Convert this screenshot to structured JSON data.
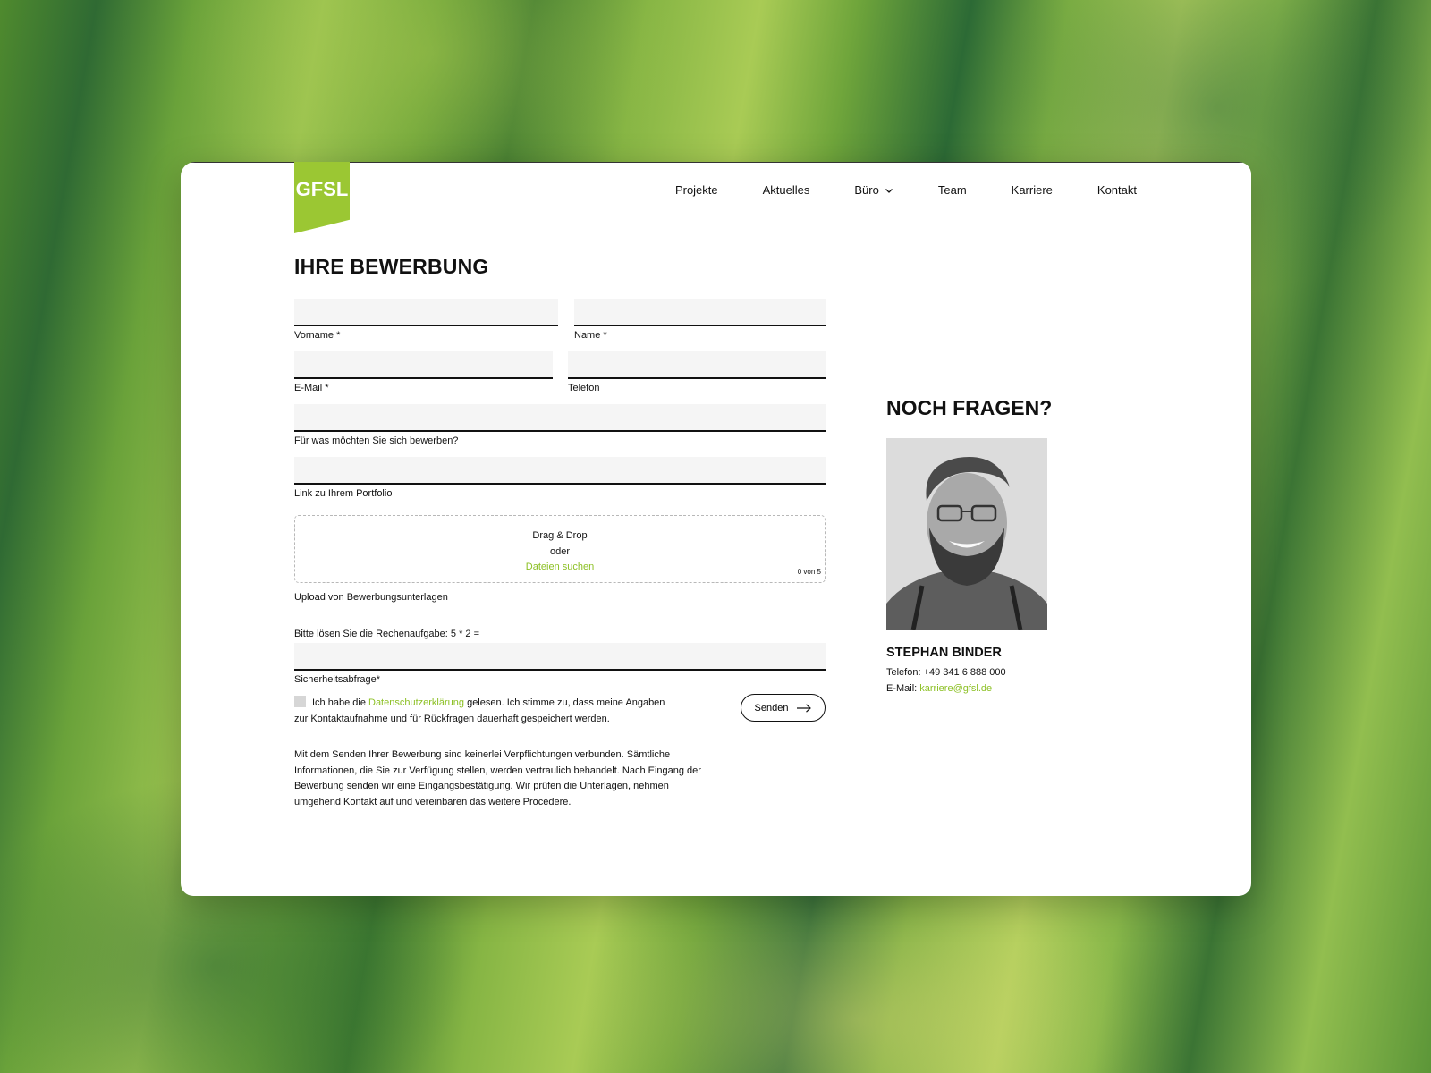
{
  "site": {
    "logo_text": "GFSL",
    "brand_color": "#9bc733",
    "link_color": "#8cc024"
  },
  "nav": {
    "items": [
      {
        "label": "Projekte"
      },
      {
        "label": "Aktuelles"
      },
      {
        "label": "Büro",
        "has_dropdown": true
      },
      {
        "label": "Team"
      },
      {
        "label": "Karriere"
      },
      {
        "label": "Kontakt"
      }
    ]
  },
  "form": {
    "title": "IHRE BEWERBUNG",
    "fields": {
      "first_name": {
        "label": "Vorname *",
        "value": ""
      },
      "last_name": {
        "label": "Name *",
        "value": ""
      },
      "email": {
        "label": "E-Mail *",
        "value": ""
      },
      "phone": {
        "label": "Telefon",
        "value": ""
      },
      "position": {
        "label": "Für was möchten Sie sich bewerben?",
        "value": ""
      },
      "portfolio": {
        "label": "Link zu Ihrem Portfolio",
        "value": ""
      }
    },
    "upload": {
      "line1": "Drag & Drop",
      "line2": "oder",
      "browse_link": "Dateien suchen",
      "count": "0 von 5",
      "label": "Upload von Bewerbungsunterlagen"
    },
    "captcha": {
      "question": "Bitte lösen Sie die Rechenaufgabe: 5 * 2 =",
      "value": "",
      "label": "Sicherheitsabfrage*"
    },
    "consent": {
      "checked": false,
      "text_before": "Ich habe die ",
      "link": "Datenschutzerklärung",
      "text_after": " gelesen. Ich stimme zu, dass meine Angaben zur Kontaktaufnahme und für Rückfragen dauerhaft gespeichert werden."
    },
    "submit_label": "Senden",
    "disclaimer": "Mit dem Senden Ihrer Bewerbung sind keinerlei Verpflichtungen verbunden. Sämtliche Informationen, die Sie zur Verfügung stellen, werden vertraulich behandelt. Nach Eingang der Bewerbung senden wir eine Eingangsbestätigung. Wir prüfen die Unterlagen, nehmen umgehend Kontakt auf und vereinbaren das weitere Procedere."
  },
  "sidebar": {
    "title": "NOCH FRAGEN?",
    "contact": {
      "name": "STEPHAN BINDER",
      "phone_label": "Telefon: ",
      "phone": "+49 341 6 888 000",
      "email_label": "E-Mail: ",
      "email": "karriere@gfsl.de",
      "photo_alt": "Portrait Stephan Binder"
    }
  }
}
